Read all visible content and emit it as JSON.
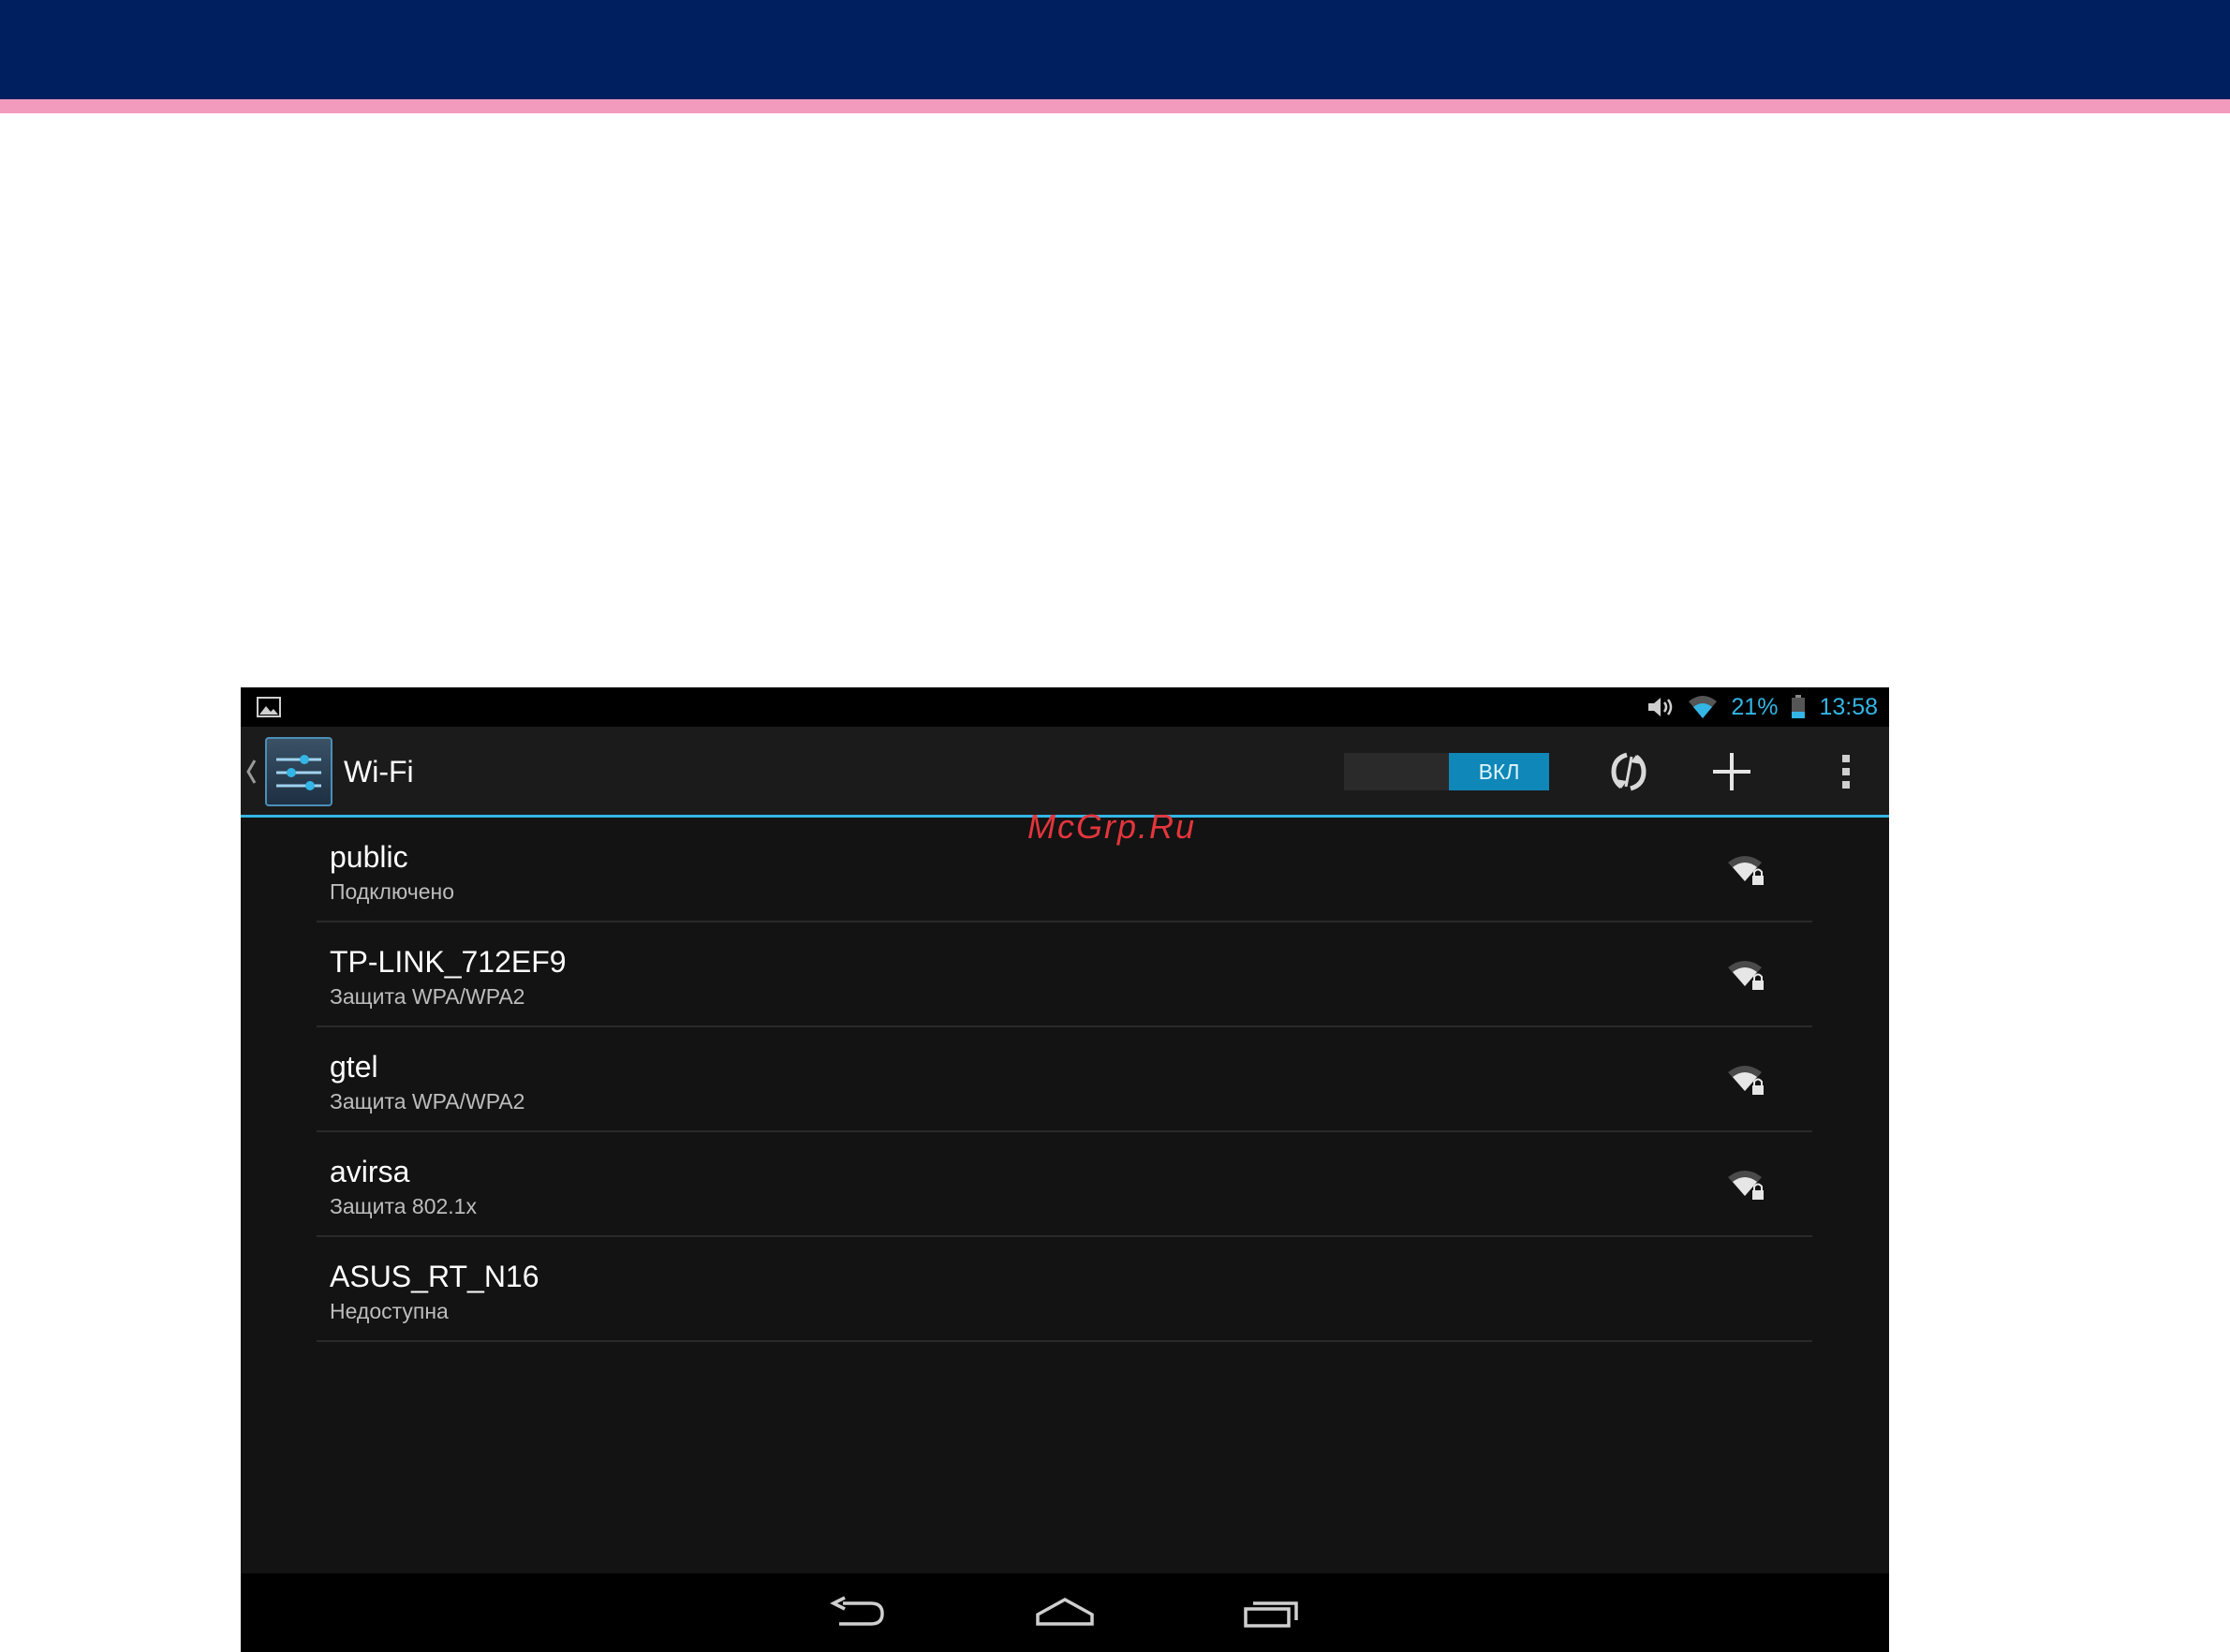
{
  "status_bar": {
    "battery_percent": "21%",
    "time": "13:58",
    "accent_color": "#33b5e5",
    "icons": [
      "picture-icon",
      "volume-icon",
      "wifi-signal-icon",
      "battery-icon"
    ]
  },
  "action_bar": {
    "title": "Wi-Fi",
    "toggle_label": "ВКЛ",
    "toggle_state": "on",
    "actions": [
      "scan-icon",
      "add-network-icon",
      "overflow-menu-icon"
    ]
  },
  "networks": [
    {
      "ssid": "public",
      "status": "Подключено",
      "signal": "strong-secured"
    },
    {
      "ssid": "TP-LINK_712EF9",
      "status": "Защита WPA/WPA2",
      "signal": "strong-secured"
    },
    {
      "ssid": "gtel",
      "status": "Защита WPA/WPA2",
      "signal": "strong-secured"
    },
    {
      "ssid": "avirsa",
      "status": "Защита 802.1x",
      "signal": "strong-secured"
    },
    {
      "ssid": "ASUS_RT_N16",
      "status": "Недоступна",
      "signal": "none"
    }
  ],
  "nav_bar": {
    "buttons": [
      "back-icon",
      "home-icon",
      "recents-icon"
    ]
  },
  "watermark": "McGrp.Ru",
  "colors": {
    "header_band": "#001f5f",
    "header_stripe": "#f29bbd",
    "toggle_on": "#0f87b8"
  }
}
